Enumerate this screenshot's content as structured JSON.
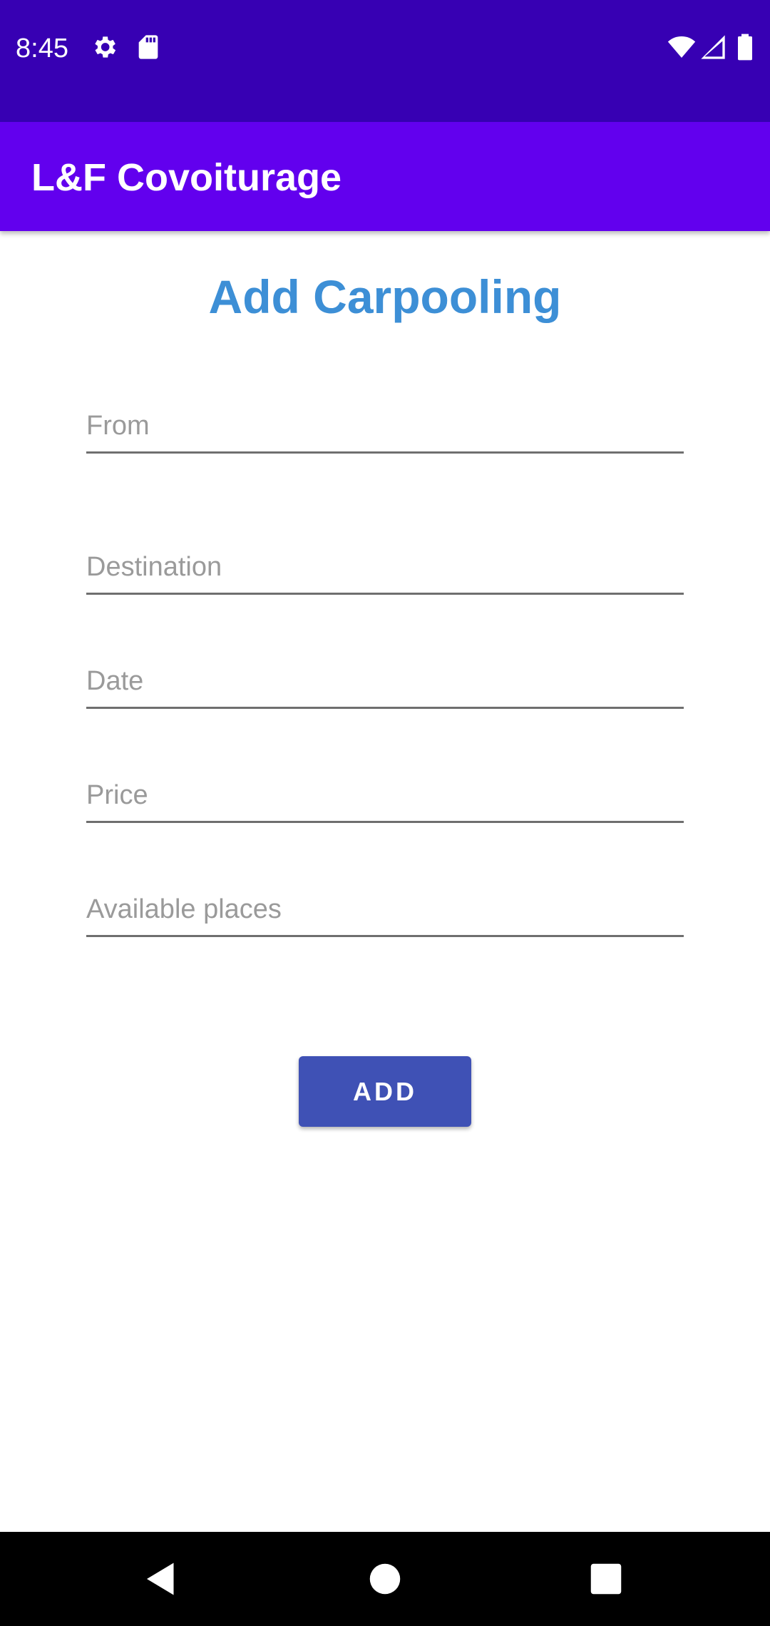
{
  "status_bar": {
    "time": "8:45",
    "icons": [
      "gear-icon",
      "sd-card-icon",
      "wifi-icon",
      "cell-signal-icon",
      "battery-icon"
    ]
  },
  "app_bar": {
    "title": "L&F Covoiturage"
  },
  "form": {
    "title": "Add Carpooling",
    "fields": [
      {
        "placeholder": "From",
        "value": ""
      },
      {
        "placeholder": "Destination",
        "value": ""
      },
      {
        "placeholder": "Date",
        "value": ""
      },
      {
        "placeholder": "Price",
        "value": ""
      },
      {
        "placeholder": "Available places",
        "value": ""
      }
    ],
    "submit_label": "ADD"
  },
  "nav_bar": {
    "buttons": [
      "back-icon",
      "home-icon",
      "recents-icon"
    ]
  },
  "colors": {
    "status_bar": "#3700b3",
    "app_bar": "#6200ee",
    "title": "#3d8fd6",
    "button": "#3f51b5"
  }
}
